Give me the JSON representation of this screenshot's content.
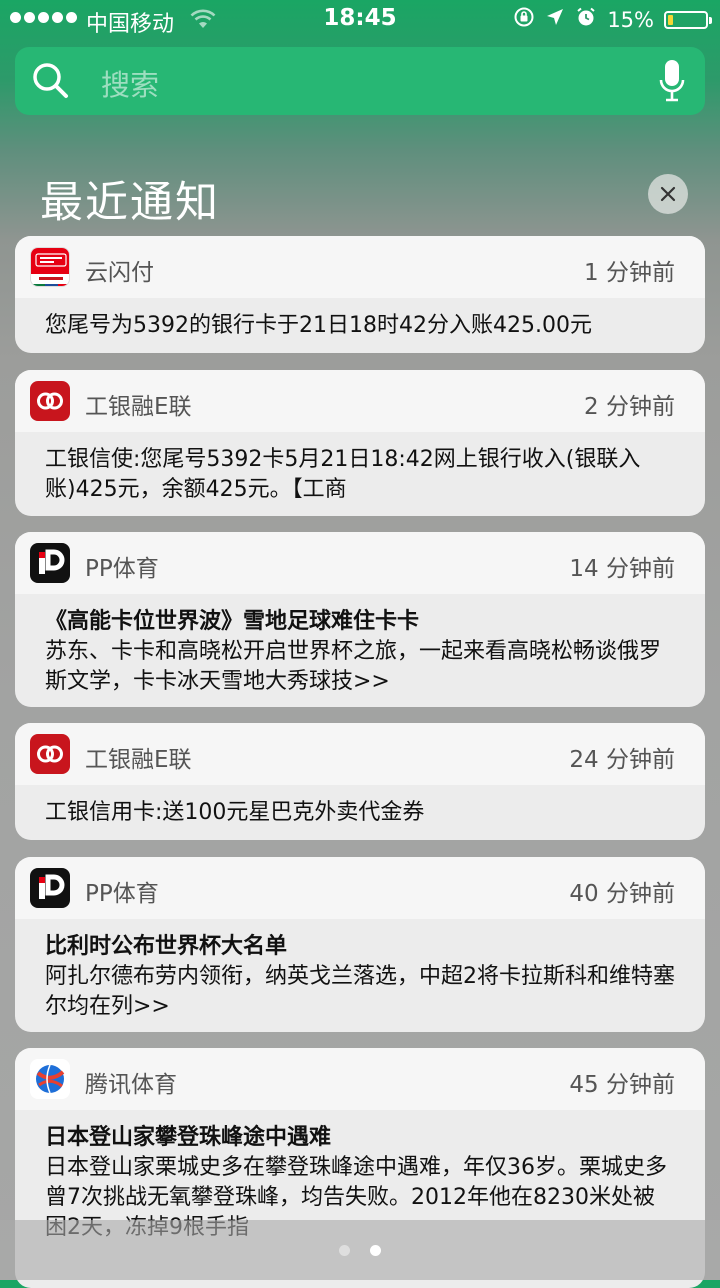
{
  "status_bar": {
    "carrier": "中国移动",
    "time": "18:45",
    "battery_percent": "15%",
    "battery_level": 0.15
  },
  "search": {
    "placeholder": "搜索",
    "icons": [
      "search-icon",
      "microphone-icon"
    ]
  },
  "section": {
    "title": "最近通知",
    "clear_icon": "close-icon"
  },
  "notifications": [
    {
      "app": "云闪付",
      "icon": "unionpay-app-icon",
      "time": "1 分钟前",
      "title": "",
      "body": "您尾号为5392的银行卡于21日18时42分入账425.00元"
    },
    {
      "app": "工银融E联",
      "icon": "icbc-app-icon",
      "time": "2 分钟前",
      "title": "",
      "body": "工银信使:您尾号5392卡5月21日18:42网上银行收入(银联入账)425元，余额425元。【工商"
    },
    {
      "app": "PP体育",
      "icon": "pp-sports-app-icon",
      "time": "14 分钟前",
      "title": "《高能卡位世界波》雪地足球难住卡卡",
      "body": "苏东、卡卡和高晓松开启世界杯之旅，一起来看高晓松畅谈俄罗斯文学，卡卡冰天雪地大秀球技>>"
    },
    {
      "app": "工银融E联",
      "icon": "icbc-app-icon",
      "time": "24 分钟前",
      "title": "",
      "body": "工银信用卡:送100元星巴克外卖代金券"
    },
    {
      "app": "PP体育",
      "icon": "pp-sports-app-icon",
      "time": "40 分钟前",
      "title": "比利时公布世界杯大名单",
      "body": "阿扎尔德布劳内领衔，纳英戈兰落选，中超2将卡拉斯科和维特塞尔均在列>>"
    },
    {
      "app": "腾讯体育",
      "icon": "tencent-sports-app-icon",
      "time": "45 分钟前",
      "title": "日本登山家攀登珠峰途中遇难",
      "body": "日本登山家栗城史多在攀登珠峰途中遇难，年仅36岁。栗城史多曾7次挑战无氧攀登珠峰，均告失败。2012年他在8230米处被困2天，冻掉9根手指"
    }
  ],
  "pager": {
    "pages": 2,
    "current": 2
  },
  "colors": {
    "accent_green": "#27b774",
    "battery_yellow": "#f6d635",
    "icbc_red": "#c8151d",
    "unionpay_red": "#e60012"
  }
}
